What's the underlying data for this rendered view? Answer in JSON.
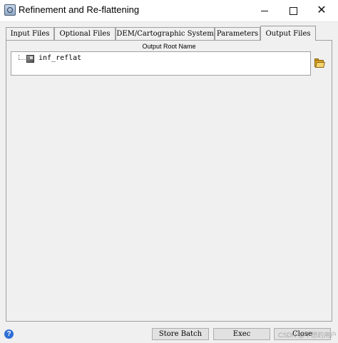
{
  "window": {
    "title": "Refinement and Re-flattening",
    "controls": {
      "minimize": "—",
      "maximize": "□",
      "close": "✕"
    }
  },
  "tabs": [
    {
      "label": "Input Files",
      "active": false
    },
    {
      "label": "Optional Files",
      "active": false
    },
    {
      "label": "DEM/Cartographic System",
      "active": false
    },
    {
      "label": "Parameters",
      "active": false
    },
    {
      "label": "Output Files",
      "active": true
    }
  ],
  "output": {
    "root_name_label": "Output Root Name",
    "tree_item_label": "inf_reflat",
    "browse_icon": "folder-open-icon"
  },
  "footer": {
    "help_icon": "help-icon",
    "help_glyph": "?",
    "store_batch_label": "Store Batch",
    "exec_label": "Exec",
    "close_label": "Close",
    "watermark": "CSDN @不想的用户"
  },
  "colors": {
    "help_blue": "#2f6fd6",
    "folder": "#d9a520",
    "background": "#f0f0f0"
  }
}
